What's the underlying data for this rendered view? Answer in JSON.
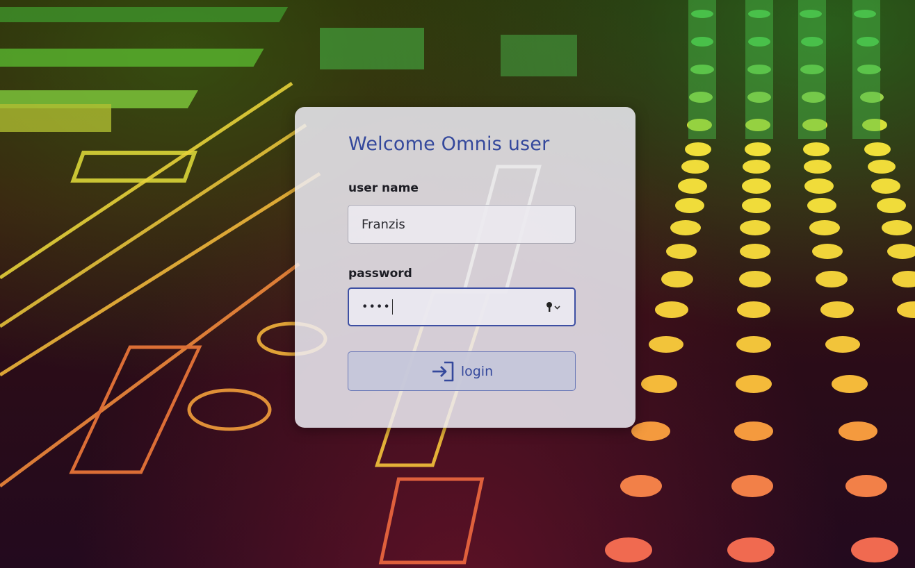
{
  "dialog": {
    "title": "Welcome Omnis user",
    "username_label": "user name",
    "username_value": "Franzis",
    "password_label": "password",
    "password_masked": "••••",
    "login_label": "login"
  },
  "icons": {
    "password_toggle": "key-icon",
    "login": "login-arrow-icon"
  },
  "colors": {
    "title": "#34489c",
    "accent_border": "#3d4fa3",
    "button_fill": "#c4c6da"
  }
}
